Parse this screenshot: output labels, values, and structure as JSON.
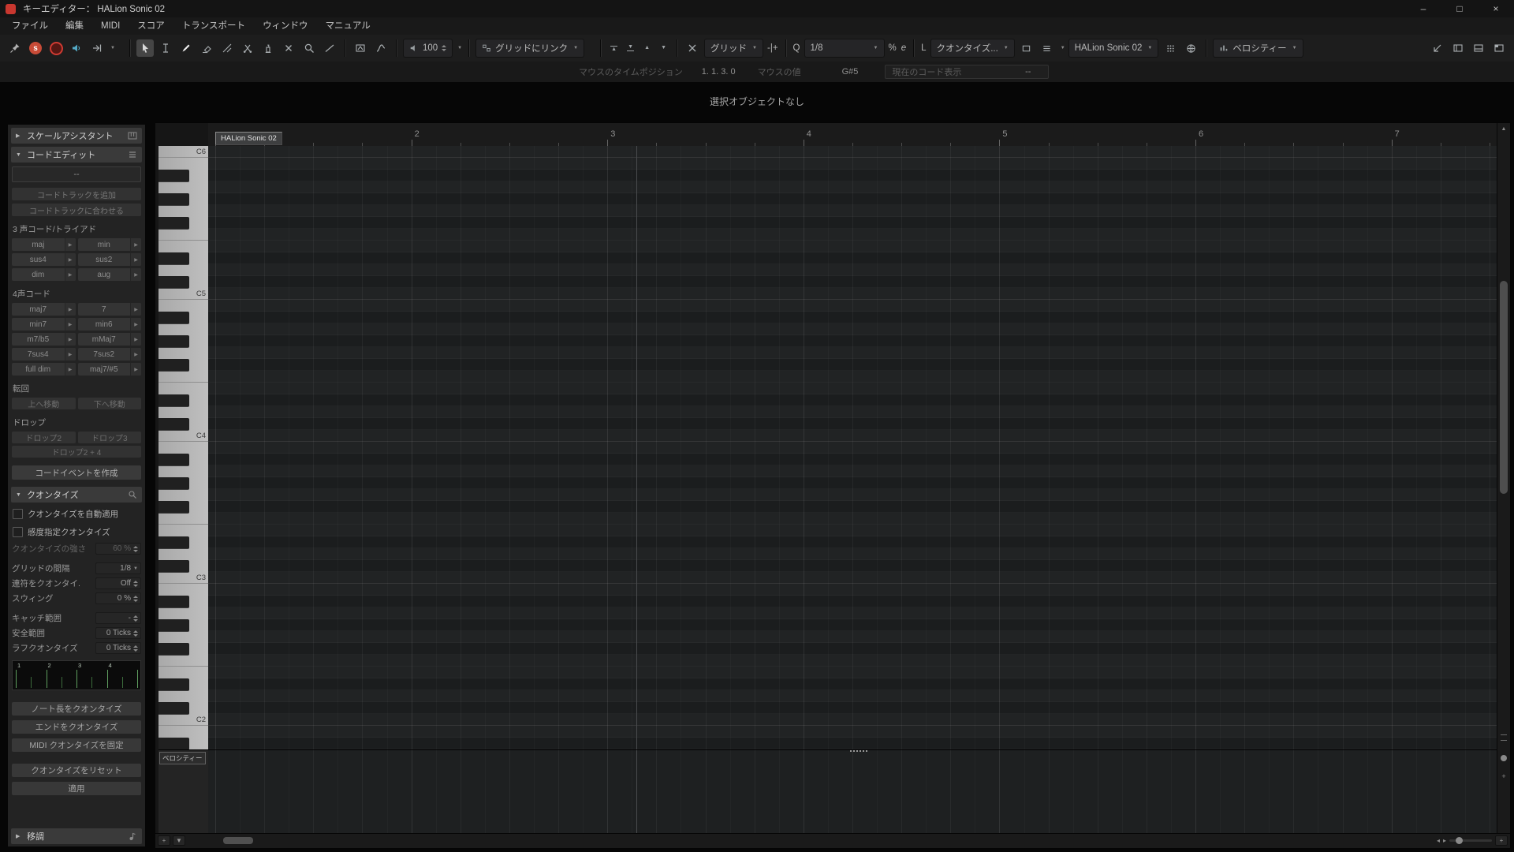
{
  "window": {
    "title": "キーエディター：  HALion Sonic 02",
    "minimize": "–",
    "maximize": "□",
    "close": "×"
  },
  "menubar": {
    "items": [
      "ファイル",
      "編集",
      "MIDI",
      "スコア",
      "トランスポート",
      "ウィンドウ",
      "マニュアル"
    ]
  },
  "toolbar": {
    "insert_velocity": "100",
    "link_to_grid": "グリッドにリンク",
    "snap_type": "グリッド",
    "grid_type_glyph": "-|+",
    "q_label": "Q",
    "quantize_preset": "1/8",
    "iq_glyph": "%",
    "open_panel_glyph": "e",
    "l_label": "L",
    "length_quantize": "クオンタイズ...",
    "part_selector": "HALion Sonic 02",
    "event_colors": "ベロシティー"
  },
  "infoline": {
    "mouse_time_label": "マウスのタイムポジション",
    "mouse_time_value": "1. 1. 3.  0",
    "mouse_value_label": "マウスの値",
    "mouse_value": "G#5",
    "chord_label": "現在のコード表示",
    "chord_value": "--"
  },
  "status": "選択オブジェクトなし",
  "inspector": {
    "sections": {
      "scale_assistant": "スケールアシスタント",
      "chord_edit": "コードエディット",
      "quantize": "クオンタイズ",
      "transpose": "移調"
    },
    "chord_edit": {
      "current": "--",
      "add_chord_track": "コードトラックを追加",
      "match_chord_track": "コードトラックに合わせる",
      "triads_label": "3 声コード/トライアド",
      "triads": [
        "maj",
        "min",
        "sus4",
        "sus2",
        "dim",
        "aug"
      ],
      "four_label": "4声コード",
      "four": [
        "maj7",
        "7",
        "min7",
        "min6",
        "m7/b5",
        "mMaj7",
        "7sus4",
        "7sus2",
        "full dim",
        "maj7/#5"
      ],
      "inversion_label": "転回",
      "inversion": [
        "上へ移動",
        "下へ移動"
      ],
      "drop_label": "ドロップ",
      "drops": [
        "ドロップ2",
        "ドロップ3"
      ],
      "drop24": "ドロップ2 + 4",
      "create_event": "コードイベントを作成"
    },
    "quantize": {
      "auto_apply": "クオンタイズを自動適用",
      "iq": "感度指定クオンタイズ",
      "rows": [
        {
          "label": "クオンタイズの強さ",
          "value": "60 %",
          "dim": true,
          "gap": false,
          "dropdown": false
        },
        {
          "label": "グリッドの間隔",
          "value": "1/8",
          "dim": false,
          "gap": true,
          "dropdown": true
        },
        {
          "label": "連符をクオンタイ.",
          "value": "Off",
          "dim": false,
          "gap": false,
          "dropdown": false
        },
        {
          "label": "スウィング",
          "value": "0 %",
          "dim": false,
          "gap": false,
          "dropdown": false
        },
        {
          "label": "キャッチ範囲",
          "value": "-",
          "dim": false,
          "gap": true,
          "dropdown": false
        },
        {
          "label": "安全範囲",
          "value": "0 Ticks",
          "dim": false,
          "gap": false,
          "dropdown": false
        },
        {
          "label": "ラフクオンタイズ",
          "value": "0 Ticks",
          "dim": false,
          "gap": false,
          "dropdown": false
        }
      ],
      "grid_numbers": [
        "1",
        "2",
        "3",
        "4"
      ],
      "buttons": [
        "ノート長をクオンタイズ",
        "エンドをクオンタイズ",
        "MIDI クオンタイズを固定"
      ],
      "reset": "クオンタイズをリセット",
      "apply": "適用"
    }
  },
  "editor": {
    "part_name": "HALion Sonic 02",
    "ruler_numbers": [
      "2",
      "3",
      "4",
      "5",
      "6",
      "7"
    ],
    "octave_labels": [
      "C6",
      "C5",
      "C4",
      "C3",
      "C2"
    ],
    "velocity_label": "ベロシティー"
  }
}
